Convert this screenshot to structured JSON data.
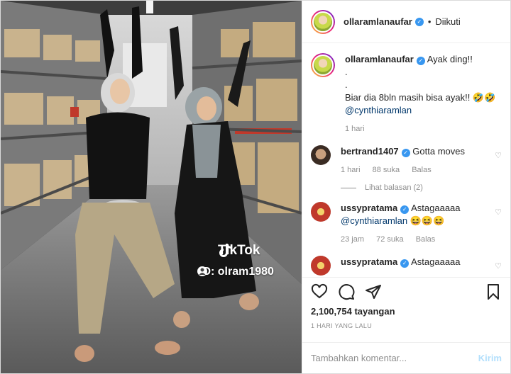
{
  "post": {
    "username": "ollaramlanaufar",
    "follow_sep": "•",
    "follow_status": "Diikuti",
    "tiktok_label": "TikTok",
    "tiktok_id": "ID: olram1980"
  },
  "caption": {
    "username": "ollaramlanaufar",
    "line1": "Ayak ding!!",
    "dot1": ".",
    "dot2": ".",
    "line2": "Biar dia 8bln masih bisa ayak!! 🤣🤣",
    "mention": "@cynthiaramlan",
    "time": "1 hari"
  },
  "comments": [
    {
      "username": "bertrand1407",
      "text": "Gotta moves",
      "time": "1 hari",
      "likes": "88 suka",
      "reply": "Balas",
      "view_replies": "Lihat balasan (2)"
    },
    {
      "username": "ussypratama",
      "text": "Astagaaaaa",
      "mention": "@cynthiaramlan",
      "emoji": "😆😆😆",
      "time": "23 jam",
      "likes": "72 suka",
      "reply": "Balas"
    },
    {
      "username": "ussypratama",
      "text": "Astagaaaaa"
    }
  ],
  "stats": {
    "views": "2,100,754 tayangan",
    "date": "1 HARI YANG LALU"
  },
  "composer": {
    "placeholder": "Tambahkan komentar...",
    "submit": "Kirim"
  },
  "icons": {
    "like": "heart-icon",
    "comment": "comment-icon",
    "share": "paper-plane-icon",
    "save": "bookmark-icon",
    "verified": "verified-badge-icon",
    "comment_like": "heart-outline-icon"
  },
  "colors": {
    "verified": "#3897f0",
    "mention": "#00376b",
    "muted": "#8e8e8e",
    "submit": "#b2dffc"
  }
}
